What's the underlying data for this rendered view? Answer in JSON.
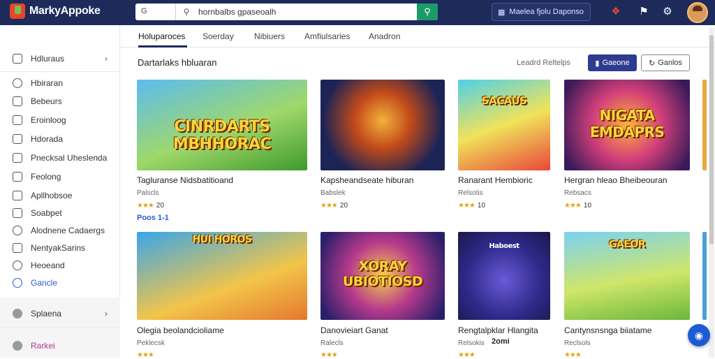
{
  "app": {
    "name": "MarkyAppoke"
  },
  "search": {
    "scope": "G",
    "placeholder": "",
    "value": "hornbalbs gpaseoalh"
  },
  "header": {
    "promo_label": "Maelea fjolu Daponso"
  },
  "tabs": [
    "Holuparoces",
    "Soerday",
    "Nibiuers",
    "Amfiulsaries",
    "Anadron"
  ],
  "sidebar": {
    "items": [
      {
        "label": "Hdluraus"
      },
      {
        "label": "Hbiraran"
      },
      {
        "label": "Bebeurs"
      },
      {
        "label": "Eroinloog"
      },
      {
        "label": "Hdorada"
      },
      {
        "label": "Pnecksal Uheslenda"
      },
      {
        "label": "Feolong"
      },
      {
        "label": "Apllhobsoe"
      },
      {
        "label": "Soabpet"
      },
      {
        "label": "Alodnene Cadaergs"
      },
      {
        "label": "NentyakSarins"
      },
      {
        "label": "Heoeand"
      },
      {
        "label": "Gancle"
      }
    ],
    "footer_section": {
      "label": "Splaena"
    },
    "footer_link": {
      "label": "Rarkei"
    }
  },
  "main": {
    "section_title": "Dartarlaks hbluaran",
    "sort_label": "Leadrd Reltelps",
    "primary_button": "Gaeone",
    "secondary_button": "Ganlos"
  },
  "cards": [
    {
      "thumb_text": "CINRDARTS MBHHORAC",
      "title": "Tagluranse Nidsbatitioand",
      "sub": "Palscls",
      "rating": "20",
      "price": "Poos  1-1"
    },
    {
      "thumb_text": "",
      "title": "Kapsheandseate hiburan",
      "sub": "Babslek",
      "rating": "20",
      "price": ""
    },
    {
      "thumb_text": "SACAUS",
      "title": "Ranarant Hembioric",
      "sub": "Relsotis",
      "rating": "10",
      "price": ""
    },
    {
      "thumb_text": "NIGATA EMDAPRS",
      "title": "Hergran hleao Bheibeouran",
      "sub": "Rebsacs",
      "rating": "10",
      "price": ""
    },
    {
      "thumb_text": "HUI HOROS",
      "title": "Olegia beolandcioliame",
      "sub": "Peklecsk",
      "rating": "",
      "price": ""
    },
    {
      "thumb_text": "XORAY UBIOTIOSD",
      "title": "Danovieiart Ganat",
      "sub": "Ralecls",
      "rating": "",
      "price": ""
    },
    {
      "thumb_text": "Haboest",
      "title": "Rengtalpklar Hlangita",
      "sub": "Relsokis",
      "rating": "",
      "price": "2omi"
    },
    {
      "thumb_text": "GAEOR",
      "title": "Cantynsnsnga biiatame",
      "sub": "Reclsols",
      "rating": "",
      "price": ""
    }
  ],
  "colors": {
    "topbar": "#1e2a5a",
    "search_button": "#1c9b6a",
    "accent": "#2a5bd7",
    "star": "#e4a21a"
  }
}
